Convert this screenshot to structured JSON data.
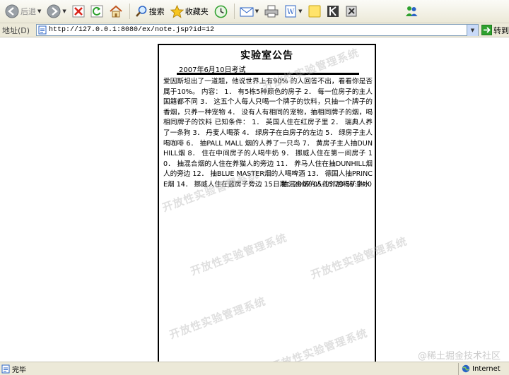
{
  "toolbar": {
    "back_label": "后退",
    "search_label": "搜索",
    "favorites_label": "收藏夹"
  },
  "addressbar": {
    "label": "地址(D)",
    "url": "http://127.0.0.1:8080/ex/note.jsp?id=12",
    "go_label": "转到"
  },
  "notice": {
    "title": "实验室公告",
    "date": "2007年6月10日考试",
    "body": "爱因斯坦出了一道题，他说世界上有90% 的人回答不出，看看你是否属于10%。 内容： 1． 有5栋5种颜色的房子 2． 每一位房子的主人国籍都不同 3． 这五个人每人只喝一个牌子的饮料，只抽一个牌子的香烟，只养一种宠物 4． 没有人有相同的宠物，抽相同牌子的烟，喝相同牌子的饮料 已知条件： 1． 英国人住在红房子里 2． 瑞典人养了一条狗 3． 丹麦人喝茶 4． 绿房子在白房子的左边 5． 绿房子主人喝咖啡 6． 抽PALL MALL 烟的人养了一只鸟 7． 黄房子主人抽DUNHILL烟 8． 住在中间房子的人喝牛奶 9． 挪威人住在第一间房子 10． 抽混合烟的人住在养猫人的旁边 11． 养马人住在抽DUNHILL烟人的旁边 12． 抽BLUE MASTER烟的人喝啤酒 13． 德国人抽PRINCE烟 14． 挪威人住在蓝房子旁边 15． 抽混合烟的人的邻居喝矿泉水",
    "footer": "日期：2007-05-15 23:59:24.0"
  },
  "watermark": "开放性实验管理系统",
  "credit": "@稀土掘金技术社区",
  "statusbar": {
    "status": "完毕",
    "zone": "Internet"
  },
  "colors": {
    "chrome": "#ece9d8",
    "ie_blue": "#2a63c6",
    "go_green": "#2ea02e"
  }
}
